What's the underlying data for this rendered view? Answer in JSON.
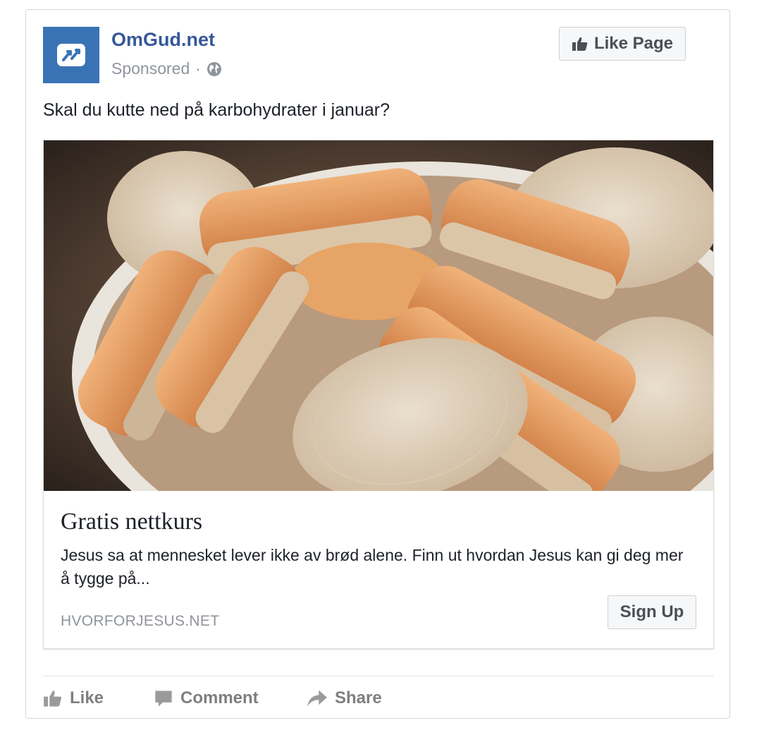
{
  "post": {
    "page_name": "OmGud.net",
    "sponsored_label": "Sponsored",
    "separator": "·",
    "like_page_label": "Like Page",
    "text": "Skal du kutte ned på karbohydrater i januar?"
  },
  "attachment": {
    "image_icon": "bread-slices-photo",
    "title": "Gratis nettkurs",
    "description": "Jesus sa at mennesket lever ikke av brød alene. Finn ut hvordan Jesus kan gi deg mer å tygge på...",
    "domain": "HVORFORJESUS.NET",
    "cta_label": "Sign Up"
  },
  "actions": {
    "like": "Like",
    "comment": "Comment",
    "share": "Share"
  },
  "colors": {
    "brand_blue": "#365899",
    "avatar_bg": "#3a73b5",
    "muted": "#90949c",
    "button_text": "#4b4f56"
  },
  "icons": {
    "avatar": "arrows-logo-icon",
    "privacy": "globe-icon",
    "like_page": "thumbs-up-icon",
    "like": "thumbs-up-icon",
    "comment": "speech-bubble-icon",
    "share": "share-arrow-icon"
  }
}
